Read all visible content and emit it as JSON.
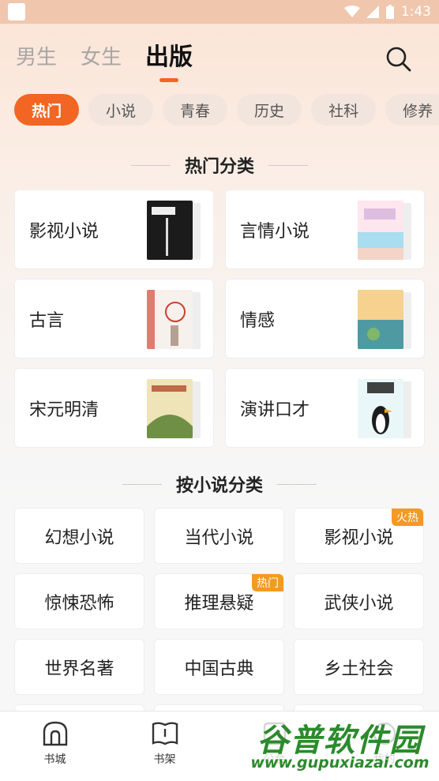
{
  "status": {
    "time": "1:43"
  },
  "top_tabs": [
    {
      "label": "男生",
      "active": false
    },
    {
      "label": "女生",
      "active": false
    },
    {
      "label": "出版",
      "active": true
    }
  ],
  "chips": [
    {
      "label": "热门",
      "active": true
    },
    {
      "label": "小说",
      "active": false
    },
    {
      "label": "青春",
      "active": false
    },
    {
      "label": "历史",
      "active": false
    },
    {
      "label": "社科",
      "active": false
    },
    {
      "label": "修养",
      "active": false
    }
  ],
  "hot_section": {
    "title": "热门分类",
    "items": [
      {
        "label": "影视小说",
        "cover_colors": [
          "#1a1a1a",
          "#3a3a3a"
        ]
      },
      {
        "label": "言情小说",
        "cover_colors": [
          "#f7c6d4",
          "#9fd8e6"
        ]
      },
      {
        "label": "古言",
        "cover_colors": [
          "#f4efe9",
          "#c8412f"
        ]
      },
      {
        "label": "情感",
        "cover_colors": [
          "#f1c77d",
          "#4e9aa1"
        ]
      },
      {
        "label": "宋元明清",
        "cover_colors": [
          "#e9dcae",
          "#6a8c3c"
        ]
      },
      {
        "label": "演讲口才",
        "cover_colors": [
          "#eaf7f8",
          "#1c1c1c"
        ]
      }
    ]
  },
  "novel_section": {
    "title": "按小说分类",
    "items": [
      {
        "label": "幻想小说",
        "badge": ""
      },
      {
        "label": "当代小说",
        "badge": ""
      },
      {
        "label": "影视小说",
        "badge": "火热"
      },
      {
        "label": "惊悚恐怖",
        "badge": ""
      },
      {
        "label": "推理悬疑",
        "badge": "热门"
      },
      {
        "label": "武侠小说",
        "badge": ""
      },
      {
        "label": "世界名著",
        "badge": ""
      },
      {
        "label": "中国古典",
        "badge": ""
      },
      {
        "label": "乡土社会",
        "badge": ""
      }
    ]
  },
  "bottom_nav": [
    {
      "label": "书城",
      "icon": "bookstore-icon"
    },
    {
      "label": "书架",
      "icon": "bookshelf-icon"
    },
    {
      "label": "公会",
      "icon": "guild-icon"
    },
    {
      "label": "我的",
      "icon": "profile-icon"
    }
  ],
  "watermark": {
    "text": "谷普软件园",
    "url": "www.gupuxiazai.com"
  },
  "colors": {
    "accent": "#f26522",
    "badge": "#f29a23",
    "statusbar": "#f0c6ad"
  }
}
